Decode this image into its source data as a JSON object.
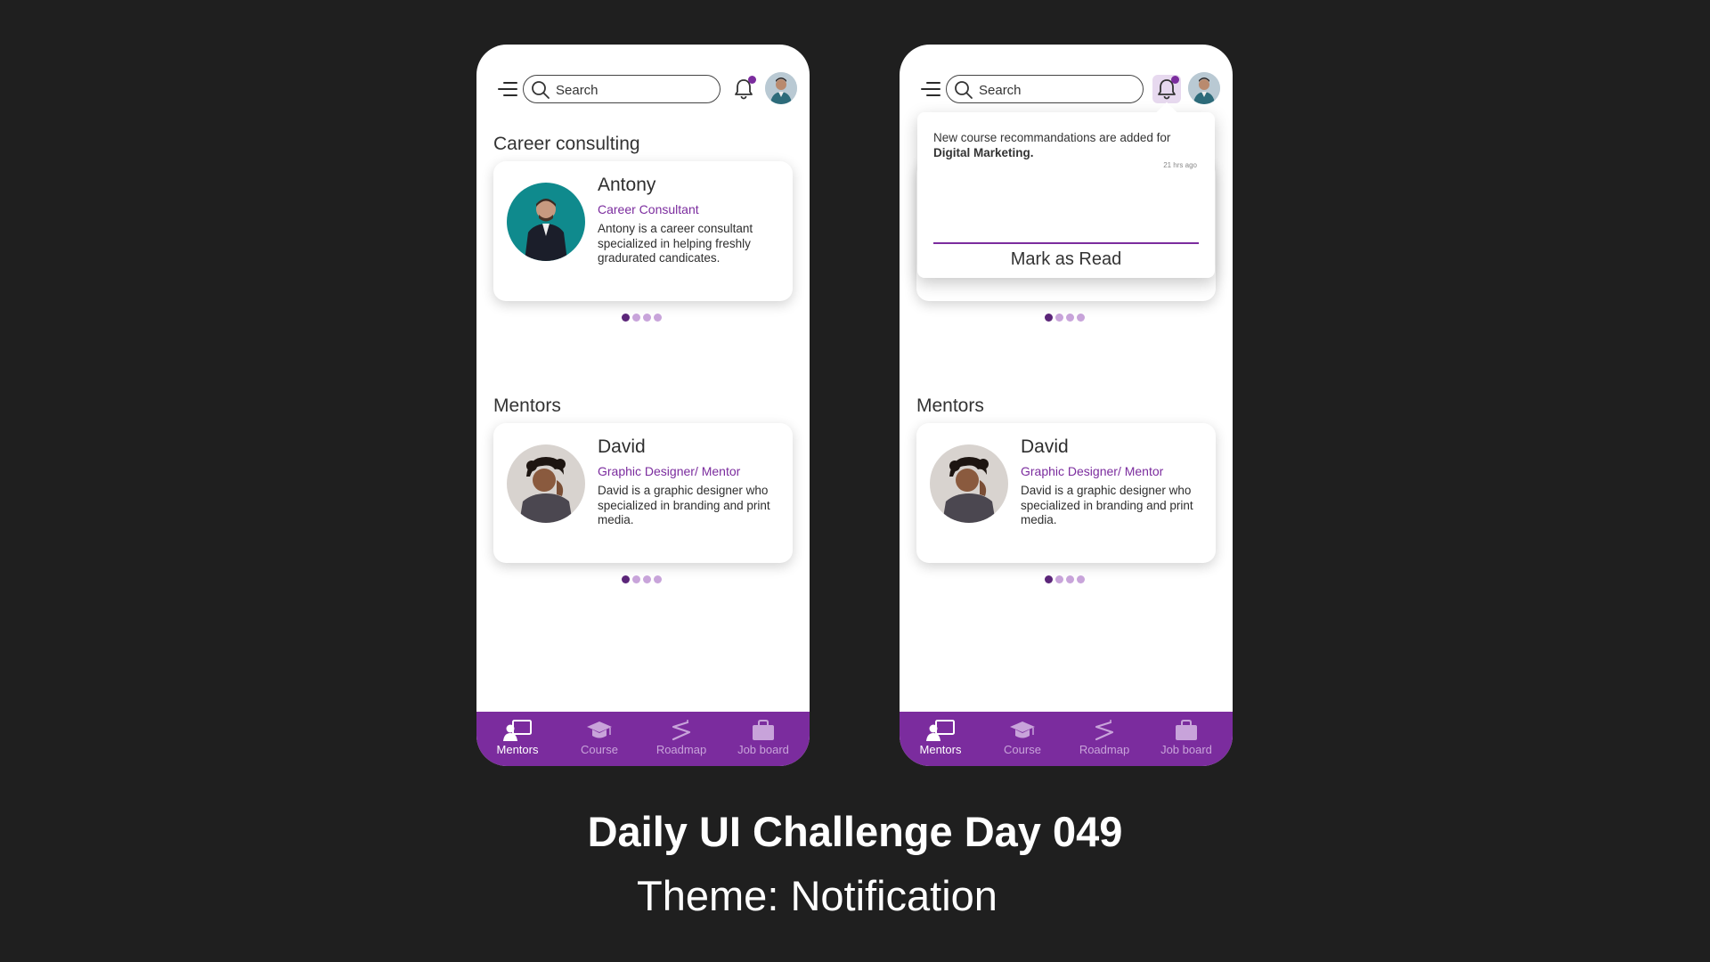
{
  "screens": [
    {
      "search": {
        "placeholder": "Search"
      },
      "career": {
        "title": "Career consulting",
        "card": {
          "name": "Antony",
          "role": "Career Consultant",
          "description": "Antony is a career consultant specialized in helping freshly gradurated candicates."
        }
      },
      "mentors": {
        "title": "Mentors",
        "card": {
          "name": "David",
          "role": "Graphic Designer/ Mentor",
          "description": "David is a graphic designer who specialized in branding and print media."
        }
      },
      "nav": [
        {
          "label": "Mentors",
          "icon": "mentors-icon",
          "active": true
        },
        {
          "label": "Course",
          "icon": "course-icon",
          "active": false
        },
        {
          "label": "Roadmap",
          "icon": "roadmap-icon",
          "active": false
        },
        {
          "label": "Job board",
          "icon": "job-board-icon",
          "active": false
        }
      ]
    },
    {
      "search": {
        "placeholder": "Search"
      },
      "notification": {
        "message_prefix": "New course recommandations are added for",
        "message_bold": "Digital Marketing.",
        "time": "21 hrs ago",
        "action": "Mark as Read"
      },
      "mentors": {
        "title": "Mentors",
        "card": {
          "name": "David",
          "role": "Graphic Designer/ Mentor",
          "description": "David is a graphic designer who specialized in branding and print media."
        }
      },
      "nav": [
        {
          "label": "Mentors",
          "icon": "mentors-icon",
          "active": true
        },
        {
          "label": "Course",
          "icon": "course-icon",
          "active": false
        },
        {
          "label": "Roadmap",
          "icon": "roadmap-icon",
          "active": false
        },
        {
          "label": "Job board",
          "icon": "job-board-icon",
          "active": false
        }
      ]
    }
  ],
  "footer": {
    "title": "Daily UI Challenge Day 049",
    "subtitle": "Theme: Notification"
  },
  "colors": {
    "background": "#1f1f1f",
    "accent": "#7b2c9e",
    "nav_inactive": "#c8a3da",
    "dot_active": "#5b2579",
    "dot_inactive": "#c8a4da"
  }
}
